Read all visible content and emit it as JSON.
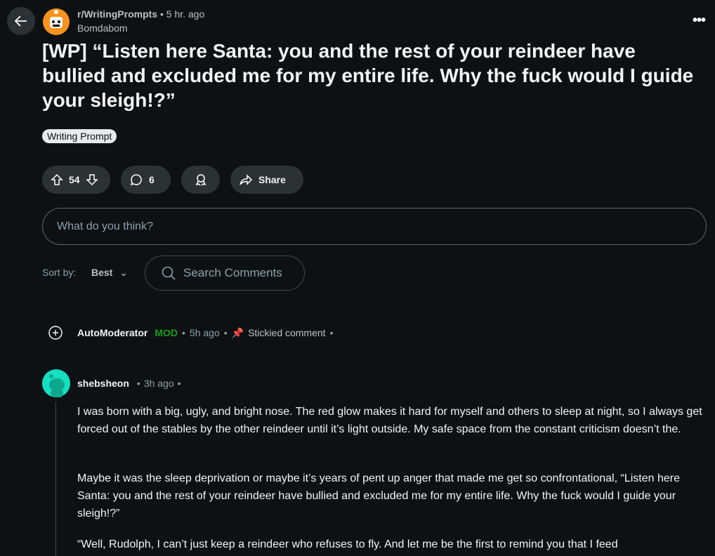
{
  "header": {
    "subreddit": "r/WritingPrompts",
    "time": "5 hr. ago",
    "author": "Bomdabom"
  },
  "post": {
    "title": "[WP] “Listen here Santa: you and the rest of your reindeer have bullied and excluded me for my entire life. Why the fuck would I guide your sleigh!?”",
    "flair": "Writing Prompt",
    "votes": "54",
    "comments": "6",
    "share_label": "Share"
  },
  "comment_box": {
    "placeholder": "What do you think?"
  },
  "sort": {
    "label": "Sort by:",
    "value": "Best"
  },
  "search": {
    "placeholder": "Search Comments"
  },
  "comments": [
    {
      "author": "AutoModerator",
      "badge": "MOD",
      "time": "5h ago",
      "stickied": "Stickied comment"
    },
    {
      "author": "shebsheon",
      "time": "3h ago",
      "paragraphs": [
        "I was born with a big, ugly, and bright nose. The red glow makes it hard for myself and others to sleep at night, so I always get forced out of the stables by the other reindeer until it’s light outside. My safe space from the constant criticism doesn’t the.",
        "Maybe it was the sleep deprivation or maybe it’s years of pent up anger that made me get so confrontational, “Listen here Santa: you and the rest of your reindeer have bullied and excluded me for my entire life. Why the fuck would I guide your sleigh!?”",
        "“Well, Rudolph, I can’t just keep a reindeer who refuses to fly. And let me be the first to remind you that I feed"
      ]
    }
  ],
  "colors": {
    "mod": "#1a9e1a",
    "bg": "#0e1113",
    "avatar": "#14e0c0"
  }
}
